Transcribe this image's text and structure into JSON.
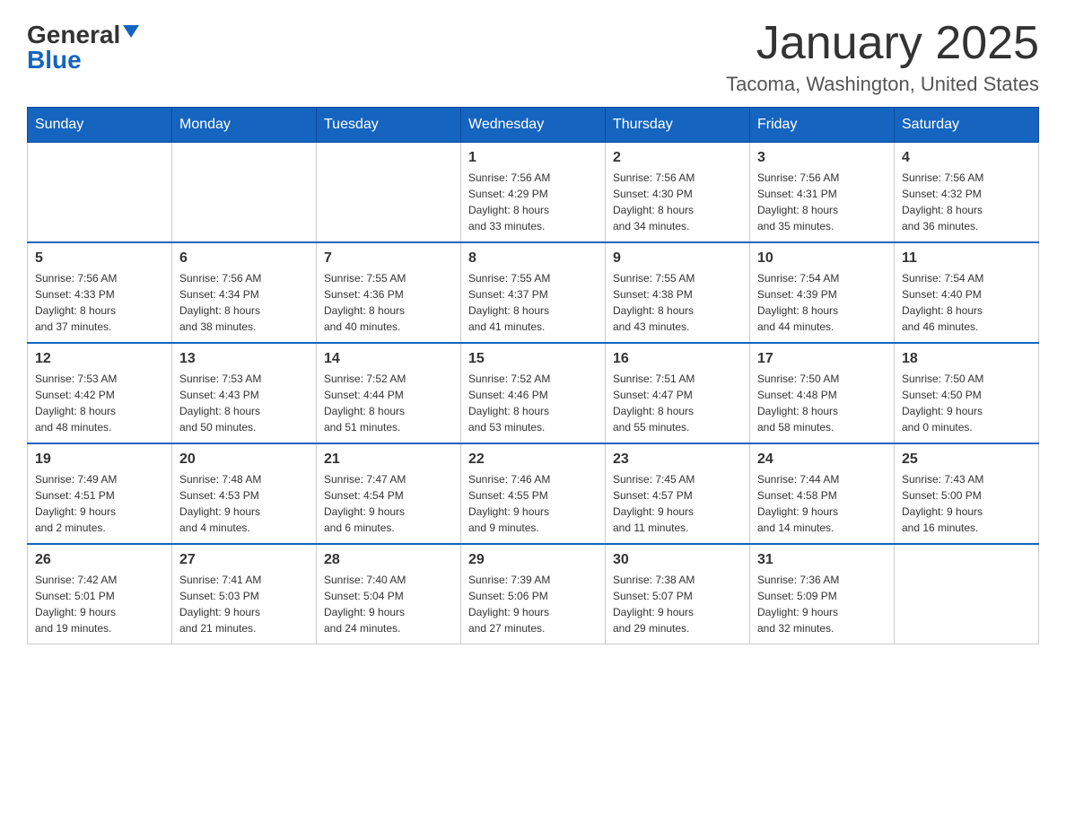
{
  "logo": {
    "general": "General",
    "blue": "Blue"
  },
  "title": "January 2025",
  "location": "Tacoma, Washington, United States",
  "days_of_week": [
    "Sunday",
    "Monday",
    "Tuesday",
    "Wednesday",
    "Thursday",
    "Friday",
    "Saturday"
  ],
  "weeks": [
    [
      {
        "day": "",
        "info": ""
      },
      {
        "day": "",
        "info": ""
      },
      {
        "day": "",
        "info": ""
      },
      {
        "day": "1",
        "info": "Sunrise: 7:56 AM\nSunset: 4:29 PM\nDaylight: 8 hours\nand 33 minutes."
      },
      {
        "day": "2",
        "info": "Sunrise: 7:56 AM\nSunset: 4:30 PM\nDaylight: 8 hours\nand 34 minutes."
      },
      {
        "day": "3",
        "info": "Sunrise: 7:56 AM\nSunset: 4:31 PM\nDaylight: 8 hours\nand 35 minutes."
      },
      {
        "day": "4",
        "info": "Sunrise: 7:56 AM\nSunset: 4:32 PM\nDaylight: 8 hours\nand 36 minutes."
      }
    ],
    [
      {
        "day": "5",
        "info": "Sunrise: 7:56 AM\nSunset: 4:33 PM\nDaylight: 8 hours\nand 37 minutes."
      },
      {
        "day": "6",
        "info": "Sunrise: 7:56 AM\nSunset: 4:34 PM\nDaylight: 8 hours\nand 38 minutes."
      },
      {
        "day": "7",
        "info": "Sunrise: 7:55 AM\nSunset: 4:36 PM\nDaylight: 8 hours\nand 40 minutes."
      },
      {
        "day": "8",
        "info": "Sunrise: 7:55 AM\nSunset: 4:37 PM\nDaylight: 8 hours\nand 41 minutes."
      },
      {
        "day": "9",
        "info": "Sunrise: 7:55 AM\nSunset: 4:38 PM\nDaylight: 8 hours\nand 43 minutes."
      },
      {
        "day": "10",
        "info": "Sunrise: 7:54 AM\nSunset: 4:39 PM\nDaylight: 8 hours\nand 44 minutes."
      },
      {
        "day": "11",
        "info": "Sunrise: 7:54 AM\nSunset: 4:40 PM\nDaylight: 8 hours\nand 46 minutes."
      }
    ],
    [
      {
        "day": "12",
        "info": "Sunrise: 7:53 AM\nSunset: 4:42 PM\nDaylight: 8 hours\nand 48 minutes."
      },
      {
        "day": "13",
        "info": "Sunrise: 7:53 AM\nSunset: 4:43 PM\nDaylight: 8 hours\nand 50 minutes."
      },
      {
        "day": "14",
        "info": "Sunrise: 7:52 AM\nSunset: 4:44 PM\nDaylight: 8 hours\nand 51 minutes."
      },
      {
        "day": "15",
        "info": "Sunrise: 7:52 AM\nSunset: 4:46 PM\nDaylight: 8 hours\nand 53 minutes."
      },
      {
        "day": "16",
        "info": "Sunrise: 7:51 AM\nSunset: 4:47 PM\nDaylight: 8 hours\nand 55 minutes."
      },
      {
        "day": "17",
        "info": "Sunrise: 7:50 AM\nSunset: 4:48 PM\nDaylight: 8 hours\nand 58 minutes."
      },
      {
        "day": "18",
        "info": "Sunrise: 7:50 AM\nSunset: 4:50 PM\nDaylight: 9 hours\nand 0 minutes."
      }
    ],
    [
      {
        "day": "19",
        "info": "Sunrise: 7:49 AM\nSunset: 4:51 PM\nDaylight: 9 hours\nand 2 minutes."
      },
      {
        "day": "20",
        "info": "Sunrise: 7:48 AM\nSunset: 4:53 PM\nDaylight: 9 hours\nand 4 minutes."
      },
      {
        "day": "21",
        "info": "Sunrise: 7:47 AM\nSunset: 4:54 PM\nDaylight: 9 hours\nand 6 minutes."
      },
      {
        "day": "22",
        "info": "Sunrise: 7:46 AM\nSunset: 4:55 PM\nDaylight: 9 hours\nand 9 minutes."
      },
      {
        "day": "23",
        "info": "Sunrise: 7:45 AM\nSunset: 4:57 PM\nDaylight: 9 hours\nand 11 minutes."
      },
      {
        "day": "24",
        "info": "Sunrise: 7:44 AM\nSunset: 4:58 PM\nDaylight: 9 hours\nand 14 minutes."
      },
      {
        "day": "25",
        "info": "Sunrise: 7:43 AM\nSunset: 5:00 PM\nDaylight: 9 hours\nand 16 minutes."
      }
    ],
    [
      {
        "day": "26",
        "info": "Sunrise: 7:42 AM\nSunset: 5:01 PM\nDaylight: 9 hours\nand 19 minutes."
      },
      {
        "day": "27",
        "info": "Sunrise: 7:41 AM\nSunset: 5:03 PM\nDaylight: 9 hours\nand 21 minutes."
      },
      {
        "day": "28",
        "info": "Sunrise: 7:40 AM\nSunset: 5:04 PM\nDaylight: 9 hours\nand 24 minutes."
      },
      {
        "day": "29",
        "info": "Sunrise: 7:39 AM\nSunset: 5:06 PM\nDaylight: 9 hours\nand 27 minutes."
      },
      {
        "day": "30",
        "info": "Sunrise: 7:38 AM\nSunset: 5:07 PM\nDaylight: 9 hours\nand 29 minutes."
      },
      {
        "day": "31",
        "info": "Sunrise: 7:36 AM\nSunset: 5:09 PM\nDaylight: 9 hours\nand 32 minutes."
      },
      {
        "day": "",
        "info": ""
      }
    ]
  ]
}
